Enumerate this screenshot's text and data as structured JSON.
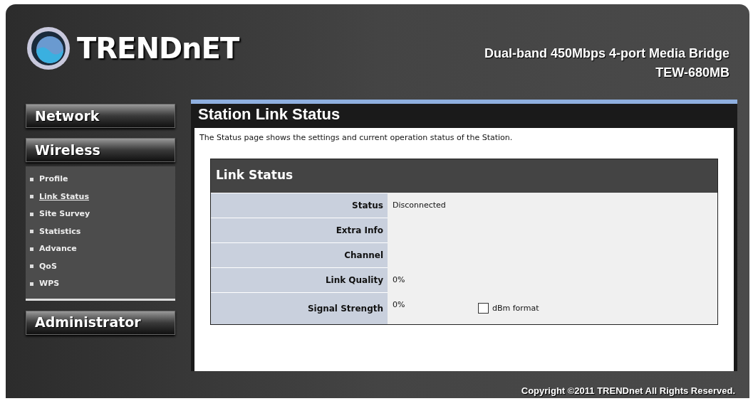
{
  "header": {
    "logo": "TRENDnET",
    "product": "Dual-band 450Mbps 4-port Media Bridge",
    "model": "TEW-680MB"
  },
  "sidebar": {
    "sections": [
      {
        "label": "Network"
      },
      {
        "label": "Wireless",
        "items": [
          {
            "label": "Profile",
            "selected": false
          },
          {
            "label": "Link Status",
            "selected": true
          },
          {
            "label": "Site Survey",
            "selected": false
          },
          {
            "label": "Statistics",
            "selected": false
          },
          {
            "label": "Advance",
            "selected": false
          },
          {
            "label": "QoS",
            "selected": false
          },
          {
            "label": "WPS",
            "selected": false
          }
        ]
      },
      {
        "label": "Administrator"
      }
    ]
  },
  "page": {
    "title": "Station Link Status",
    "description": "The Status page shows the settings and current operation status of the Station.",
    "table": {
      "title": "Link Status",
      "rows": [
        {
          "label": "Status",
          "value": "Disconnected"
        },
        {
          "label": "Extra Info"
        },
        {
          "label": "Channel"
        },
        {
          "label": "Link Quality",
          "value": "0%"
        },
        {
          "label": "Signal Strength",
          "value": "0%",
          "checkbox": {
            "label": "dBm format",
            "checked": false
          }
        }
      ]
    }
  },
  "footer": {
    "copyright": "Copyright ©2011 TRENDnet All Rights Reserved."
  }
}
